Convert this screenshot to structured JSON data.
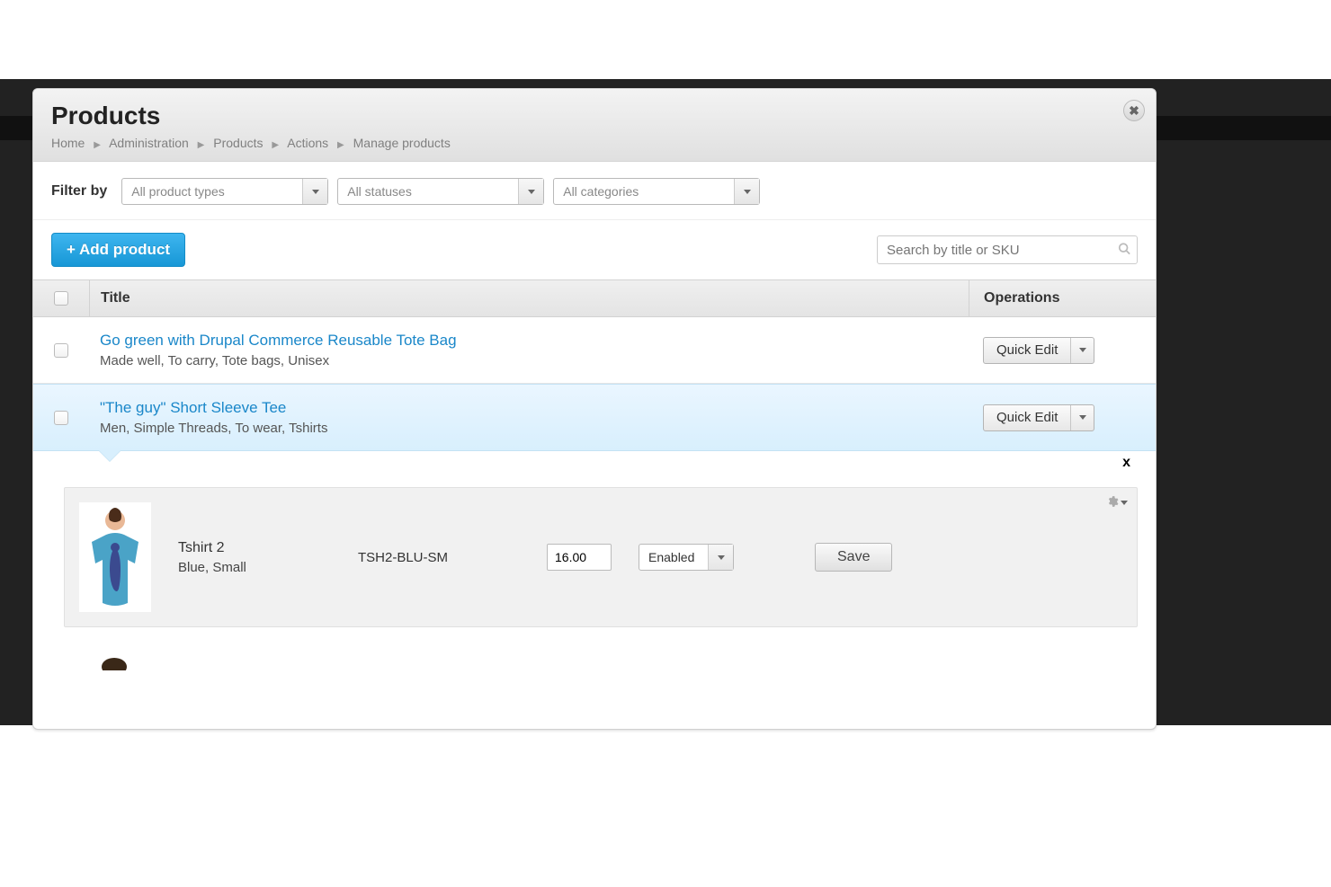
{
  "header": {
    "title": "Products",
    "breadcrumb": [
      "Home",
      "Administration",
      "Products",
      "Actions",
      "Manage products"
    ]
  },
  "filters": {
    "label": "Filter by",
    "product_type": "All product types",
    "status": "All statuses",
    "category": "All categories"
  },
  "toolbar": {
    "add_product": "+  Add product",
    "search_placeholder": "Search by title or SKU"
  },
  "table": {
    "col_title": "Title",
    "col_ops": "Operations",
    "quick_edit": "Quick Edit",
    "close_x": "x",
    "rows": [
      {
        "title": "Go green with Drupal Commerce Reusable Tote Bag",
        "subtitle": "Made well, To carry, Tote bags, Unisex"
      },
      {
        "title": "\"The guy\" Short Sleeve Tee",
        "subtitle": "Men, Simple Threads, To wear, Tshirts"
      }
    ]
  },
  "detail": {
    "name": "Tshirt 2",
    "variant": "Blue, Small",
    "sku": "TSH2-BLU-SM",
    "price": "16.00",
    "status": "Enabled",
    "save": "Save"
  }
}
